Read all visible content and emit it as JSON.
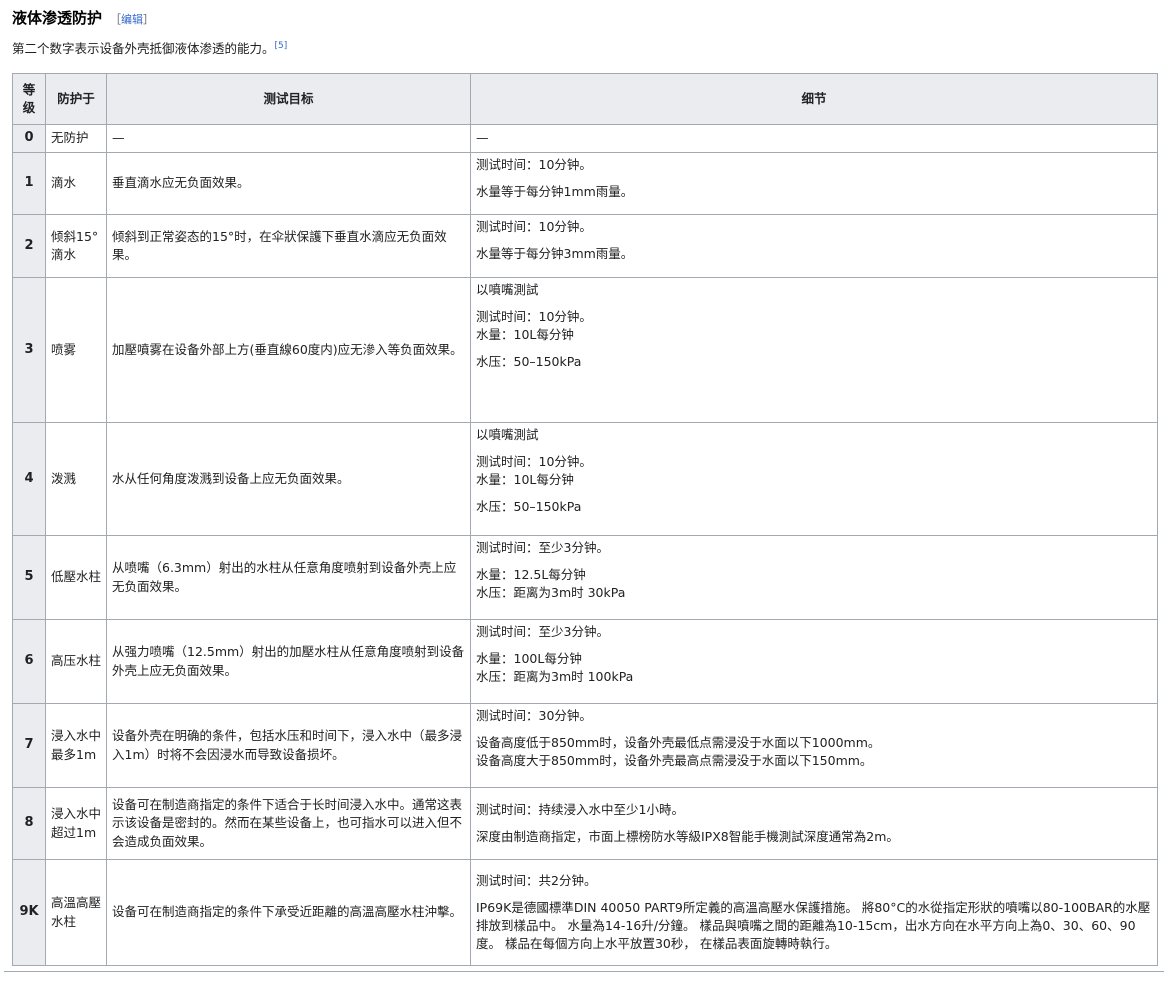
{
  "section": {
    "title": "液体渗透防护",
    "edit_bracket_open": "［",
    "edit_label": "编辑",
    "edit_bracket_close": "］",
    "intro": "第二个数字表示设备外壳抵御液体渗透的能力。",
    "ref": "[5]"
  },
  "table": {
    "headers": {
      "level": "等级",
      "protects": "防护于",
      "target": "测试目标",
      "detail": "细节"
    },
    "rows": [
      {
        "level": "0",
        "protects": "无防护",
        "target": "—",
        "details": [
          "—"
        ]
      },
      {
        "level": "1",
        "protects": "滴水",
        "target": "垂直滴水应无负面效果。",
        "details": [
          "测试时间：10分钟。",
          "水量等于每分钟1mm雨量。"
        ]
      },
      {
        "level": "2",
        "protects": "倾斜15°滴水",
        "target": "倾斜到正常姿态的15°时，在伞狀保護下垂直水滴应无负面效果。",
        "details": [
          "测试时间：10分钟。",
          "水量等于每分钟3mm雨量。"
        ]
      },
      {
        "level": "3",
        "protects": "喷雾",
        "target": "加壓噴雾在设备外部上方(垂直線60度内)应无滲入等负面效果。",
        "details": [
          "以噴嘴測試",
          "测试时间：10分钟。",
          "水量：10L每分钟",
          "水压：50–150kPa"
        ]
      },
      {
        "level": "4",
        "protects": "泼溅",
        "target": "水从任何角度泼溅到设备上应无负面效果。",
        "details": [
          "以噴嘴測試",
          "测试时间：10分钟。",
          "水量：10L每分钟",
          "水压：50–150kPa"
        ]
      },
      {
        "level": "5",
        "protects": "低壓水柱",
        "target": "从喷嘴（6.3mm）射出的水柱从任意角度喷射到设备外壳上应无负面效果。",
        "details": [
          "测试时间：至少3分钟。",
          "水量：12.5L每分钟",
          "水压：距离为3m时 30kPa"
        ]
      },
      {
        "level": "6",
        "protects": "高压水柱",
        "target": "从强力喷嘴（12.5mm）射出的加壓水柱从任意角度喷射到设备外壳上应无负面效果。",
        "details": [
          "测试时间：至少3分钟。",
          "水量：100L每分钟",
          "水压：距离为3m时 100kPa"
        ]
      },
      {
        "level": "7",
        "protects": "浸入水中最多1m",
        "target": "设备外壳在明确的条件，包括水压和时间下，浸入水中（最多浸入1m）时将不会因浸水而导致设备损坏。",
        "details": [
          "测试时间：30分钟。",
          "设备高度低于850mm时，设备外壳最低点需浸没于水面以下1000mm。",
          "设备高度大于850mm时，设备外壳最高点需浸没于水面以下150mm。"
        ]
      },
      {
        "level": "8",
        "protects": "浸入水中超过1m",
        "target": "设备可在制造商指定的条件下适合于长时间浸入水中。通常这表示该设备是密封的。然而在某些设备上，也可指水可以进入但不会造成负面效果。",
        "details": [
          "测试时间：持续浸入水中至少1小時。",
          "深度由制造商指定，市面上標榜防水等級IPX8智能手機測試深度通常為2m。"
        ]
      },
      {
        "level": "9K",
        "protects": "高溫高壓水柱",
        "target": "设备可在制造商指定的条件下承受近距離的高溫高壓水柱沖擊。",
        "details": [
          "测试时间：共2分钟。",
          "IP69K是德國標準DIN 40050 PART9所定義的高溫高壓水保護措施。 將80°C的水從指定形狀的噴嘴以80-100BAR的水壓排放到樣品中。 水量為14-16升/分鐘。 樣品與噴嘴之間的距離為10-15cm，出水方向在水平方向上為0、30、60、90度。 樣品在每個方向上水平放置30秒， 在樣品表面旋轉時執行。"
        ]
      }
    ]
  }
}
